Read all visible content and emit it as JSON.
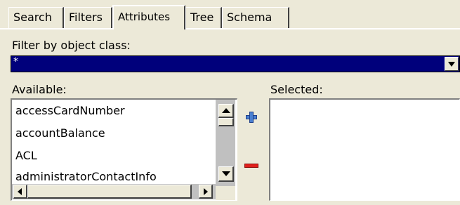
{
  "tabs": [
    {
      "label": "Search",
      "active": false
    },
    {
      "label": "Filters",
      "active": false
    },
    {
      "label": "Attributes",
      "active": true
    },
    {
      "label": "Tree",
      "active": false
    },
    {
      "label": "Schema",
      "active": false
    }
  ],
  "filter": {
    "label": "Filter by object class:",
    "value": "*"
  },
  "available": {
    "label": "Available:",
    "items": [
      "accessCardNumber",
      "accountBalance",
      "ACL",
      "administratorContactInfo"
    ]
  },
  "selected": {
    "label": "Selected:",
    "items": []
  },
  "icons": {
    "add": "plus-icon",
    "remove": "minus-icon"
  },
  "colors": {
    "window_bg": "#ece9d8",
    "selection_bg": "#00007b",
    "add_icon": "#4a7fd0",
    "remove_icon": "#e0201c"
  }
}
